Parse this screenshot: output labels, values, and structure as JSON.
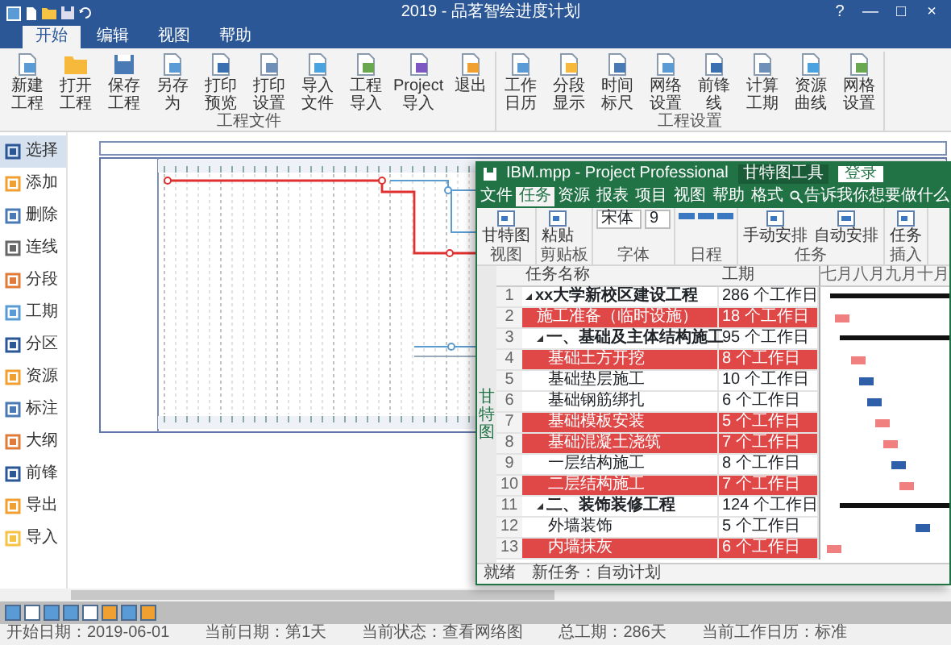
{
  "app": {
    "title": "2019 - 品茗智绘进度计划",
    "window_controls": [
      "?",
      "—",
      "□",
      "×"
    ]
  },
  "tabs": [
    {
      "label": "开始",
      "selected": true
    },
    {
      "label": "编辑",
      "selected": false
    },
    {
      "label": "视图",
      "selected": false
    },
    {
      "label": "帮助",
      "selected": false
    }
  ],
  "ribbon": {
    "groups": [
      {
        "label": "工程文件",
        "buttons": [
          "新建工程",
          "打开工程",
          "保存工程",
          "另存为",
          "打印预览",
          "打印设置",
          "导入文件",
          "工程导入",
          "Project导入",
          "退出"
        ]
      },
      {
        "label": "工程设置",
        "buttons": [
          "工作日历",
          "分段显示",
          "时间标尺",
          "网络设置",
          "前锋线",
          "计算工期",
          "资源曲线",
          "网格设置"
        ]
      }
    ]
  },
  "sidebar": {
    "items": [
      {
        "label": "选择",
        "selected": true
      },
      {
        "label": "添加",
        "selected": false
      },
      {
        "label": "删除",
        "selected": false
      },
      {
        "label": "连线",
        "selected": false
      },
      {
        "label": "分段",
        "selected": false
      },
      {
        "label": "工期",
        "selected": false
      },
      {
        "label": "分区",
        "selected": false
      },
      {
        "label": "资源",
        "selected": false
      },
      {
        "label": "标注",
        "selected": false
      },
      {
        "label": "大纲",
        "selected": false
      },
      {
        "label": "前锋",
        "selected": false
      },
      {
        "label": "导出",
        "selected": false
      },
      {
        "label": "导入",
        "selected": false
      }
    ]
  },
  "project_window": {
    "title": "IBM.mpp - Project Professional",
    "context_tab": "甘特图工具",
    "sign_in": "登录",
    "tabs": [
      {
        "label": "文件",
        "selected": false
      },
      {
        "label": "任务",
        "selected": true
      },
      {
        "label": "资源",
        "selected": false
      },
      {
        "label": "报表",
        "selected": false
      },
      {
        "label": "项目",
        "selected": false
      },
      {
        "label": "视图",
        "selected": false
      },
      {
        "label": "帮助",
        "selected": false
      },
      {
        "label": "格式",
        "selected": false
      }
    ],
    "tell_me": "告诉我你想要做什么",
    "ribbon_groups": [
      {
        "label": "视图",
        "kind": "buttons",
        "buttons": [
          "甘特图"
        ]
      },
      {
        "label": "剪贴板",
        "kind": "buttons",
        "buttons": [
          "粘贴"
        ]
      },
      {
        "label": "字体",
        "kind": "fields",
        "buttons": [
          "宋体",
          "9"
        ]
      },
      {
        "label": "日程",
        "kind": "icons"
      },
      {
        "label": "任务",
        "kind": "buttons",
        "buttons": [
          "手动安排",
          "自动安排"
        ]
      },
      {
        "label": "插入",
        "kind": "buttons",
        "buttons": [
          "任务"
        ]
      }
    ],
    "side_label": "甘特图",
    "columns": [
      "任务名称",
      "工期"
    ],
    "timescale": [
      "七月",
      "八月",
      "九月",
      "十月"
    ],
    "tasks": [
      {
        "id": "1",
        "name": "xx大学新校区建设工程",
        "duration": "286 个工作日",
        "critical": false,
        "expanded": true,
        "children": [
          {
            "id": "2",
            "name": "施工准备（临时设施）",
            "duration": "18 个工作日",
            "critical": true
          },
          {
            "id": "3",
            "name": "一、基础及主体结构施工",
            "duration": "95 个工作日",
            "critical": false,
            "expanded": true,
            "children": [
              {
                "id": "4",
                "name": "基础土方开挖",
                "duration": "8 个工作日",
                "critical": true
              },
              {
                "id": "5",
                "name": "基础垫层施工",
                "duration": "10 个工作日",
                "critical": false
              },
              {
                "id": "6",
                "name": "基础钢筋绑扎",
                "duration": "6 个工作日",
                "critical": false
              },
              {
                "id": "7",
                "name": "基础模板安装",
                "duration": "5 个工作日",
                "critical": true
              },
              {
                "id": "8",
                "name": "基础混凝土浇筑",
                "duration": "7 个工作日",
                "critical": true
              },
              {
                "id": "9",
                "name": "一层结构施工",
                "duration": "8 个工作日",
                "critical": false
              },
              {
                "id": "10",
                "name": "二层结构施工",
                "duration": "7 个工作日",
                "critical": true
              }
            ]
          },
          {
            "id": "11",
            "name": "二、装饰装修工程",
            "duration": "124 个工作日",
            "critical": false,
            "expanded": true,
            "children": [
              {
                "id": "12",
                "name": "外墙装饰",
                "duration": "5 个工作日",
                "critical": false
              },
              {
                "id": "13",
                "name": "内墙抹灰",
                "duration": "6 个工作日",
                "critical": true
              }
            ]
          }
        ]
      }
    ],
    "status": [
      "就绪",
      "新任务：自动计划"
    ]
  },
  "status_bar": [
    "开始日期：2019-06-01",
    "当前日期：第1天",
    "当前状态：查看网络图",
    "总工期：286天",
    "当前工作日历：标准"
  ]
}
